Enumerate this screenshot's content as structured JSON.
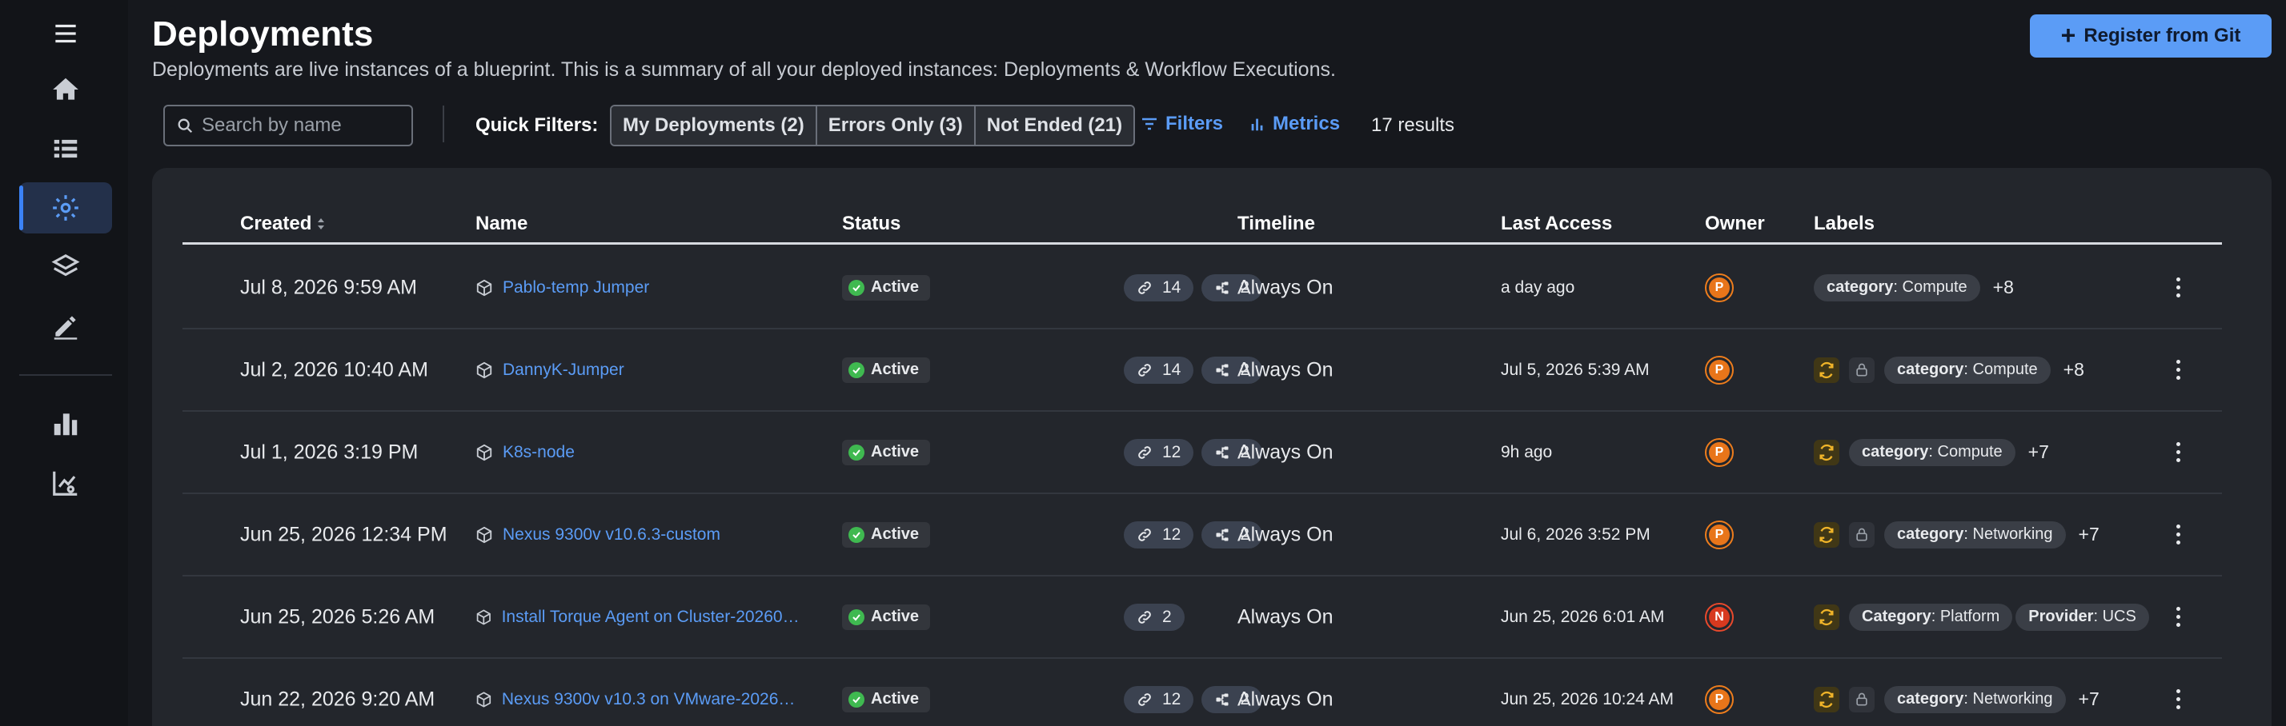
{
  "header": {
    "title": "Deployments",
    "subtitle": "Deployments are live instances of a blueprint. This is a summary of all your deployed instances: Deployments & Workflow Executions.",
    "register_label": "Register from Git"
  },
  "toolbar": {
    "search_placeholder": "Search by name",
    "quick_filters_label": "Quick Filters:",
    "quick_filters": [
      "My Deployments (2)",
      "Errors Only (3)",
      "Not Ended (21)"
    ],
    "filters_label": "Filters",
    "metrics_label": "Metrics",
    "results": "17 results"
  },
  "table": {
    "columns": {
      "created": "Created",
      "name": "Name",
      "status": "Status",
      "timeline": "Timeline",
      "last_access": "Last Access",
      "owner": "Owner",
      "labels": "Labels"
    },
    "rows": [
      {
        "created": "Jul 8, 2026 9:59 AM",
        "name": "Pablo-temp Jumper",
        "status": "Active",
        "links": "14",
        "nodes": "2",
        "timeline": "Always On",
        "last_access": "a day ago",
        "owner": "P",
        "label_key": "category",
        "label_value": "Compute",
        "label2_key": "",
        "label2_value": "",
        "more": "+8"
      },
      {
        "created": "Jul 2, 2026 10:40 AM",
        "name": "DannyK-Jumper",
        "status": "Active",
        "links": "14",
        "nodes": "2",
        "timeline": "Always On",
        "last_access": "Jul 5, 2026 5:39 AM",
        "owner": "P",
        "label_key": "category",
        "label_value": "Compute",
        "label2_key": "",
        "label2_value": "",
        "more": "+8"
      },
      {
        "created": "Jul 1, 2026 3:19 PM",
        "name": "K8s-node",
        "status": "Active",
        "links": "12",
        "nodes": "2",
        "timeline": "Always On",
        "last_access": "9h ago",
        "owner": "P",
        "label_key": "category",
        "label_value": "Compute",
        "label2_key": "",
        "label2_value": "",
        "more": "+7"
      },
      {
        "created": "Jun 25, 2026 12:34 PM",
        "name": "Nexus 9300v v10.6.3-custom",
        "status": "Active",
        "links": "12",
        "nodes": "2",
        "timeline": "Always On",
        "last_access": "Jul 6, 2026 3:52 PM",
        "owner": "P",
        "label_key": "category",
        "label_value": "Networking",
        "label2_key": "",
        "label2_value": "",
        "more": "+7"
      },
      {
        "created": "Jun 25, 2026 5:26 AM",
        "name": "Install Torque Agent on Cluster-20260603...",
        "status": "Active",
        "links": "2",
        "nodes": "",
        "timeline": "Always On",
        "last_access": "Jun 25, 2026 6:01 AM",
        "owner": "N",
        "label_key": "Category",
        "label_value": "Platform",
        "label2_key": "Provider",
        "label2_value": "UCS",
        "more": ""
      },
      {
        "created": "Jun 22, 2026 9:20 AM",
        "name": "Nexus 9300v v10.3 on VMware-2026062...",
        "status": "Active",
        "links": "12",
        "nodes": "2",
        "timeline": "Always On",
        "last_access": "Jun 25, 2026 10:24 AM",
        "owner": "P",
        "label_key": "category",
        "label_value": "Networking",
        "label2_key": "",
        "label2_value": "",
        "more": "+7"
      }
    ]
  },
  "colors": {
    "accent": "#5b9cf6",
    "active_green": "#3fb950",
    "owner_orange": "#e8751a",
    "owner_red": "#d7391f"
  },
  "icons": [
    "menu-icon",
    "home-icon",
    "blueprints-icon",
    "deployments-icon",
    "layers-icon",
    "edit-icon",
    "reports-icon",
    "monitor-icon",
    "search-icon",
    "plus-icon",
    "filter-icon",
    "metrics-icon",
    "cube-icon",
    "link-icon",
    "nodes-icon",
    "sync-icon",
    "lock-icon",
    "kebab-icon"
  ]
}
